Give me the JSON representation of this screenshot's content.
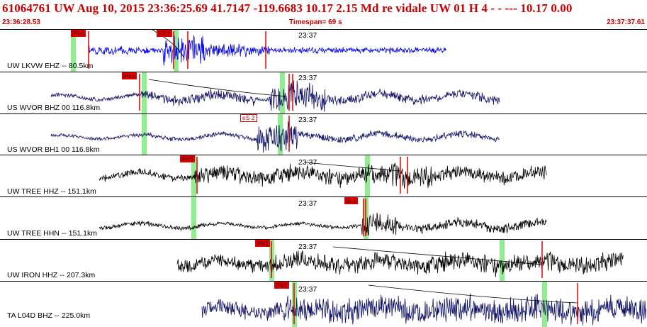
{
  "header": {
    "event_line": "61064761 UW Aug 10, 2015 23:36:25.69    41.7147 -119.6683 10.17 2.15 Md re    vidale    UW 01 H    4  -  - --- 10.17 0.00",
    "start_time": "23:36:28.53",
    "timespan": "Timespan=  69 s",
    "end_time": "23:37:37.61"
  },
  "colors": {
    "header_text": "#cc0000",
    "pick_red": "#e00000",
    "window_green": "#90ee90"
  },
  "panels": [
    {
      "label": "UW LKVW EHZ -- 80.5km",
      "time_tick": "23:37",
      "color": "#0000ee",
      "picks": [
        {
          "label": "iPc0",
          "style": "filled"
        },
        {
          "label": "eS 2",
          "style": "filled"
        }
      ]
    },
    {
      "label": "US WVOR BHZ 00 116.8km",
      "time_tick": "23:37",
      "color": "#111166",
      "picks": [
        {
          "label": "iPc1",
          "style": "filled"
        }
      ]
    },
    {
      "label": "US WVOR BH1 00 116.8km",
      "time_tick": "23:37",
      "color": "#111166",
      "picks": [
        {
          "label": "eS 2",
          "style": "outline"
        }
      ]
    },
    {
      "label": "UW TREE HHZ -- 151.1km",
      "time_tick": "23:37",
      "color": "#000000",
      "picks": [
        {
          "label": "iPc0",
          "style": "filled"
        }
      ]
    },
    {
      "label": "UW TREE HHN -- 151.1km",
      "time_tick": "23:37",
      "color": "#000000",
      "picks": [
        {
          "label": "iS 1",
          "style": "filled"
        }
      ]
    },
    {
      "label": "UW IRON HHZ -- 207.3km",
      "time_tick": "23:37",
      "color": "#000000",
      "picks": [
        {
          "label": "iPd1",
          "style": "filled"
        }
      ]
    },
    {
      "label": "TA L04D BHZ -- 225.0km",
      "time_tick": "23:37",
      "color": "#111166",
      "picks": [
        {
          "label": "iPd1",
          "style": "filled"
        }
      ]
    }
  ]
}
